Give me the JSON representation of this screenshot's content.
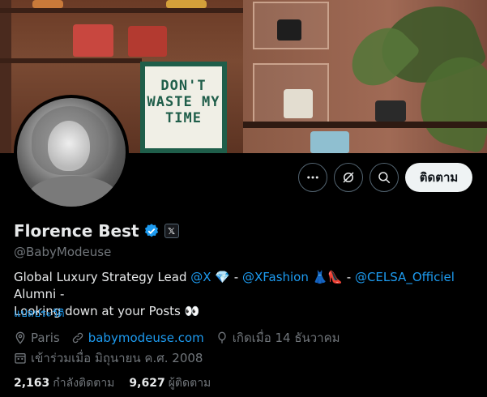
{
  "banner": {
    "poster_text": "DON'T WASTE MY TIME"
  },
  "profile": {
    "name": "Florence Best",
    "handle": "@BabyModeuse",
    "affiliate_badge": "𝕏"
  },
  "actions": {
    "more_icon": "more-dots-icon",
    "grok_icon": "grok-icon",
    "search_icon": "search-icon",
    "follow_label": "ติดตาม"
  },
  "bio": {
    "line1_prefix": "Global Luxury Strategy Lead ",
    "mention_x": "@X",
    "emoji_gem": "💎",
    "dash1": " - ",
    "mention_xfashion": "@XFashion",
    "emoji_dress_heel": " 👗👠",
    "dash2": " - ",
    "mention_celsa": "@CELSA_Officiel",
    "alumni": " Alumni -",
    "line2": "Looking down at your Posts 👀",
    "translate": "แปลประวัติ"
  },
  "meta": {
    "location": "Paris",
    "website": "babymodeuse.com",
    "birthday": "เกิดเมื่อ 14 ธันวาคม",
    "joined": "เข้าร่วมเมื่อ มิถุนายน ค.ศ. 2008"
  },
  "stats": {
    "following_count": "2,163",
    "following_label": "กำลังติดตาม",
    "followers_count": "9,627",
    "followers_label": "ผู้ติดตาม"
  },
  "colors": {
    "accent": "#1d9bf0",
    "muted": "#71767b",
    "text": "#e7e9ea",
    "background": "#000000"
  }
}
